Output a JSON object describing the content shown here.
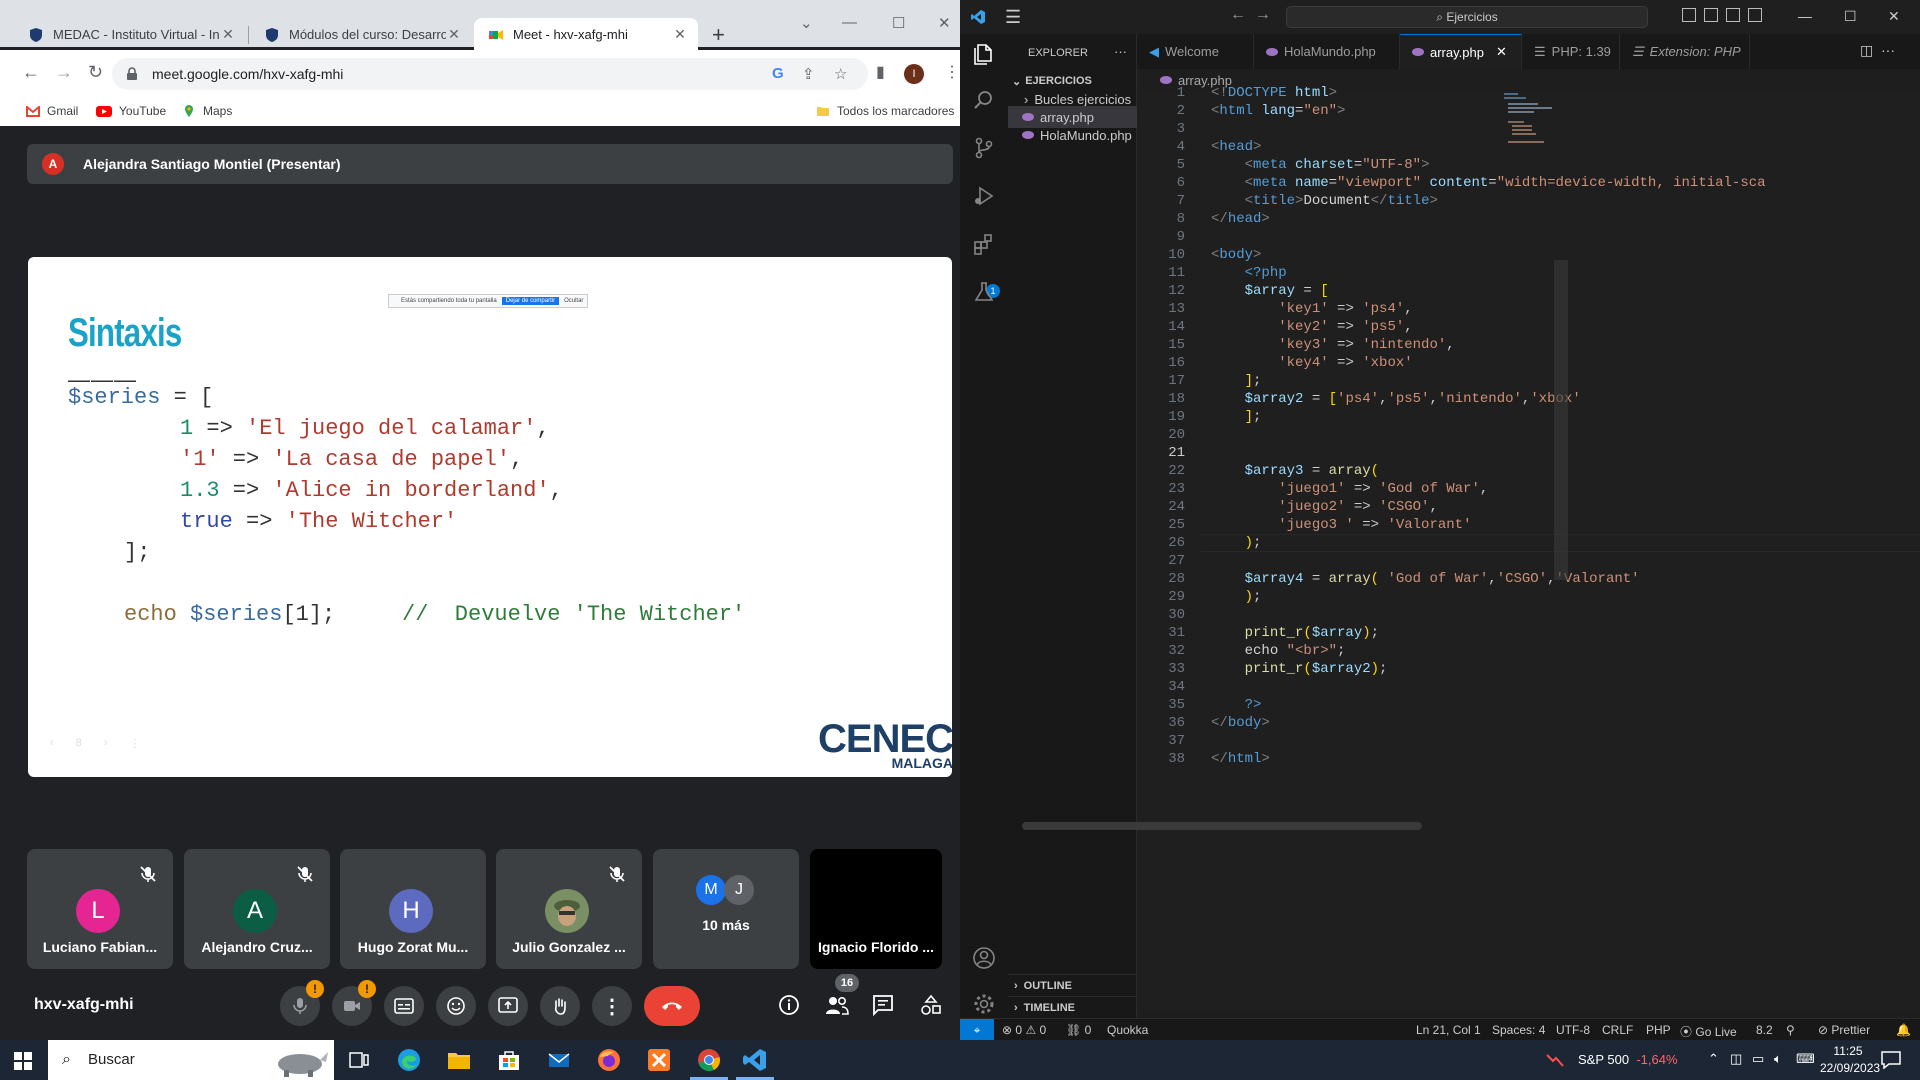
{
  "chrome": {
    "tabs": [
      {
        "title": "MEDAC - Instituto Virtual - Inic"
      },
      {
        "title": "Módulos del curso: Desarrollo"
      },
      {
        "title": "Meet - hxv-xafg-mhi"
      }
    ],
    "new_tab": "+",
    "url": "meet.google.com/hxv-xafg-mhi",
    "profile_initial": "I",
    "bookmarks": [
      "Gmail",
      "YouTube",
      "Maps"
    ],
    "all_bookmarks": "Todos los marcadores"
  },
  "meet": {
    "presenter_initial": "A",
    "presenter_name": "Alejandra Santiago Montiel (Presentar)",
    "share_banner": "Estás compartiendo toda tu pantalla",
    "share_stop": "Dejar de compartir",
    "share_hide": "Ocultar",
    "slide": {
      "title": "Sintaxis",
      "dashes": "———",
      "page": "8",
      "logo_main": "CENEC",
      "logo_sub": "MALAGA",
      "code": {
        "l1_var": "$series",
        "l1_rest": " = [",
        "l2_key": "1",
        "l2_arrow": " => ",
        "l2_val": "'El juego del calamar'",
        "l2_end": ",",
        "l3_key": "'1'",
        "l3_arrow": " => ",
        "l3_val": "'La casa de papel'",
        "l3_end": ",",
        "l4_key": "1.3",
        "l4_arrow": " => ",
        "l4_val": "'Alice in borderland'",
        "l4_end": ",",
        "l5_key": "true",
        "l5_arrow": " => ",
        "l5_val": "'The Witcher'",
        "l6": "];",
        "l7_echo": "echo ",
        "l7_var": "$series",
        "l7_rest": "[1];",
        "l7_comment": "//  Devuelve 'The Witcher'"
      }
    },
    "participants": [
      {
        "initial": "L",
        "name": "Luciano Fabian...",
        "color": "#e52592",
        "muted": true
      },
      {
        "initial": "A",
        "name": "Alejandro Cruz...",
        "color": "#0b5e43",
        "muted": true
      },
      {
        "initial": "H",
        "name": "Hugo Zorat Mu...",
        "color": "#5c6bc0",
        "muted": false
      },
      {
        "initial": "",
        "name": "Julio Gonzalez ...",
        "color": "#6d8a5a",
        "muted": true
      }
    ],
    "more": {
      "avatars": [
        "M",
        "J"
      ],
      "label": "10 más"
    },
    "black_tile_name": "Ignacio Florido ...",
    "meeting_code": "hxv-xafg-mhi",
    "badge_mark": "!",
    "people_count": "16"
  },
  "vscode": {
    "search": "Ejercicios",
    "explorer_title": "EXPLORER",
    "folder": "EJERCICIOS",
    "tree": [
      "Bucles ejercicios",
      "array.php",
      "HolaMundo.php"
    ],
    "outline": "OUTLINE",
    "timeline": "TIMELINE",
    "tabs": [
      "Welcome",
      "HolaMundo.php",
      "array.php",
      "PHP: 1.39",
      "Extension: PHP"
    ],
    "breadcrumb": "array.php",
    "extensions_badge": "1",
    "status": {
      "errors": "0",
      "warnings": "0",
      "ports": "0",
      "quokka": "Quokka",
      "position": "Ln 21, Col 1",
      "spaces": "Spaces: 4",
      "encoding": "UTF-8",
      "eol": "CRLF",
      "language": "PHP",
      "golive": "Go Live",
      "version": "8.2",
      "prettier": "Prettier"
    }
  },
  "taskbar": {
    "search_placeholder": "Buscar",
    "sp500_label": "S&P 500",
    "sp500_change": "-1,64%",
    "time": "11:25",
    "date": "22/09/2023"
  }
}
